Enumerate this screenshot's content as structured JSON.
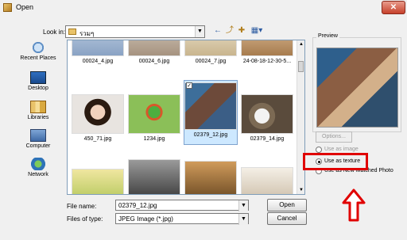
{
  "window": {
    "title": "Open",
    "close": "✕"
  },
  "lookin": {
    "label": "Look in:",
    "folder": "รวมๆ"
  },
  "toolbar": {
    "back": "←",
    "up": "⤴",
    "new_folder": "✚",
    "view": "▦▾"
  },
  "places": [
    {
      "label": "Recent Places",
      "icon": "recent-places-icon"
    },
    {
      "label": "Desktop",
      "icon": "desktop-icon"
    },
    {
      "label": "Libraries",
      "icon": "libraries-icon"
    },
    {
      "label": "Computer",
      "icon": "computer-icon"
    },
    {
      "label": "Network",
      "icon": "network-icon"
    }
  ],
  "files": {
    "row1": [
      "00024_4.jpg",
      "00024_6.jpg",
      "00024_7.jpg",
      "24-08-18-12-30-5..."
    ],
    "row2": [
      "450_71.jpg",
      "1234.jpg",
      "02379_12.jpg",
      "02379_14.jpg"
    ]
  },
  "file_name": {
    "label": "File name:",
    "value": "02379_12.jpg"
  },
  "file_type": {
    "label": "Files of type:",
    "value": "JPEG Image (*.jpg)"
  },
  "buttons": {
    "open": "Open",
    "cancel": "Cancel",
    "options": "Options..."
  },
  "preview": {
    "title": "Preview"
  },
  "radios": [
    {
      "label": "Use as image",
      "checked": false,
      "disabled": true
    },
    {
      "label": "Use as texture",
      "checked": true,
      "disabled": false
    },
    {
      "label": "Use as New Matched Photo",
      "checked": false,
      "disabled": false
    }
  ],
  "colors": {
    "highlight": "#e00000",
    "selection": "#cde8ff"
  }
}
